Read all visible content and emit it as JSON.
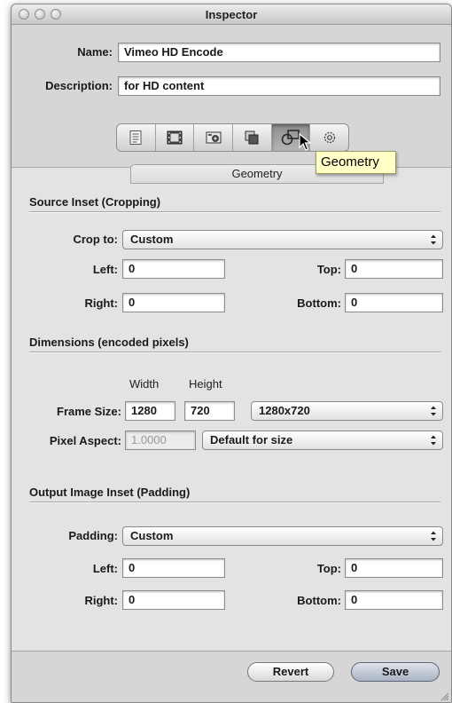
{
  "window": {
    "title": "Inspector"
  },
  "header": {
    "name_label": "Name:",
    "name_value": "Vimeo HD Encode",
    "description_label": "Description:",
    "description_value": "for HD content",
    "toolbar_icons": [
      "summary-icon",
      "video-icon",
      "encoder-icon",
      "frame-controls-icon",
      "geometry-icon",
      "actions-icon"
    ],
    "active_tab": "Geometry",
    "tooltip": "Geometry"
  },
  "source_inset": {
    "title": "Source Inset (Cropping)",
    "crop_label": "Crop to:",
    "crop_value": "Custom",
    "left_label": "Left:",
    "left_value": "0",
    "top_label": "Top:",
    "top_value": "0",
    "right_label": "Right:",
    "right_value": "0",
    "bottom_label": "Bottom:",
    "bottom_value": "0"
  },
  "dimensions": {
    "title": "Dimensions (encoded pixels)",
    "width_header": "Width",
    "height_header": "Height",
    "frame_size_label": "Frame Size:",
    "width_value": "1280",
    "height_value": "720",
    "frame_size_preset": "1280x720",
    "pixel_aspect_label": "Pixel Aspect:",
    "pixel_aspect_value": "1.0000",
    "pixel_aspect_preset": "Default for size"
  },
  "output_inset": {
    "title": "Output Image Inset (Padding)",
    "padding_label": "Padding:",
    "padding_value": "Custom",
    "left_label": "Left:",
    "left_value": "0",
    "top_label": "Top:",
    "top_value": "0",
    "right_label": "Right:",
    "right_value": "0",
    "bottom_label": "Bottom:",
    "bottom_value": "0"
  },
  "footer": {
    "revert_label": "Revert",
    "save_label": "Save"
  },
  "colors": {
    "window_bg": "#e3e3e3",
    "tooltip_bg": "#ffffc6",
    "default_button": "#a9b3c2"
  }
}
